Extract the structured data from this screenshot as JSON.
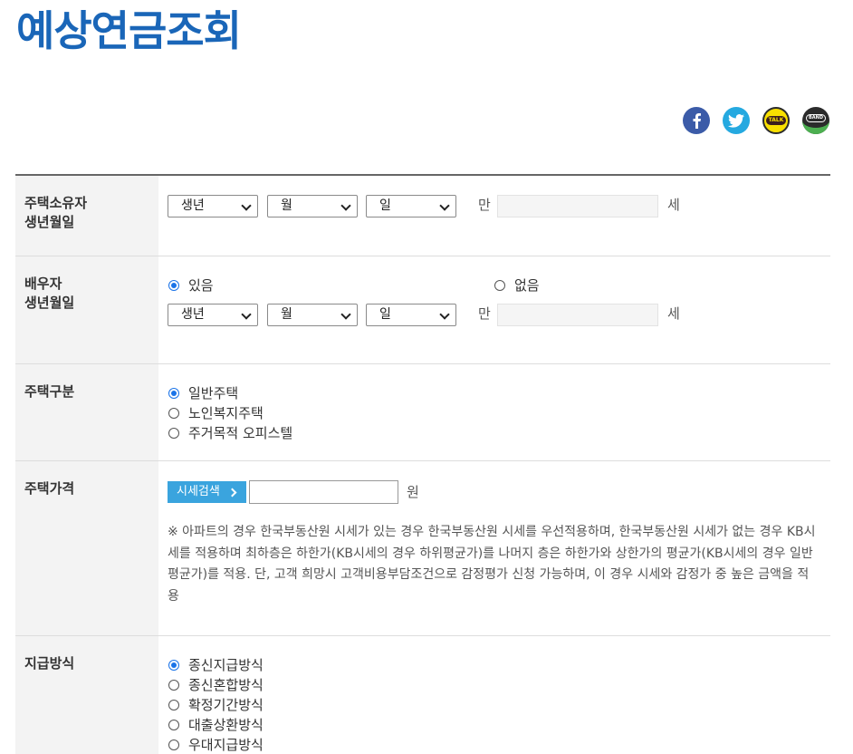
{
  "title": "예상연금조회",
  "share_icons": [
    "facebook-icon",
    "twitter-icon",
    "kakaotalk-icon",
    "band-icon"
  ],
  "share_text": {
    "kakaotalk": "TALK",
    "band": "BAND"
  },
  "owner_birth": {
    "label": "주택소유자\n생년월일",
    "year": "생년",
    "month": "월",
    "day": "일",
    "age_prefix": "만",
    "age_value": "",
    "age_suffix": "세"
  },
  "spouse_birth": {
    "label": "배우자\n생년월일",
    "options": [
      {
        "label": "있음",
        "checked": true
      },
      {
        "label": "없음",
        "checked": false
      }
    ],
    "year": "생년",
    "month": "월",
    "day": "일",
    "age_prefix": "만",
    "age_value": "",
    "age_suffix": "세"
  },
  "house_type": {
    "label": "주택구분",
    "options": [
      {
        "label": "일반주택",
        "checked": true
      },
      {
        "label": "노인복지주택",
        "checked": false
      },
      {
        "label": "주거목적 오피스텔",
        "checked": false
      }
    ]
  },
  "house_price": {
    "label": "주택가격",
    "search_button": "시세검색",
    "value": "",
    "unit": "원",
    "notice": "※ 아파트의 경우 한국부동산원 시세가 있는 경우 한국부동산원 시세를 우선적용하며, 한국부동산원 시세가 없는 경우 KB시세를 적용하며 최하층은 하한가(KB시세의 경우 하위평균가)를 나머지 층은 하한가와 상한가의 평균가(KB시세의 경우 일반평균가)를 적용. 단, 고객 희망시 고객비용부담조건으로 감정평가 신청 가능하며, 이 경우 시세와 감정가 중 높은 금액을 적용"
  },
  "payment_method": {
    "label": "지급방식",
    "options": [
      {
        "label": "종신지급방식",
        "checked": true
      },
      {
        "label": "종신혼합방식",
        "checked": false
      },
      {
        "label": "확정기간방식",
        "checked": false
      },
      {
        "label": "대출상환방식",
        "checked": false
      },
      {
        "label": "우대지급방식",
        "checked": false
      }
    ]
  },
  "colors": {
    "title": "#1a66b8",
    "accent": "#3aa4de",
    "radio_checked": "#1a73e8",
    "label_bg": "#f3f3f3"
  }
}
